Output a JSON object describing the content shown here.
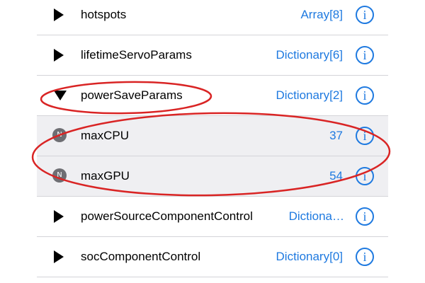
{
  "accent_color": "#1f7ae0",
  "annotation_color": "#d92424",
  "info_icon_glyph": "i",
  "rows": [
    {
      "key": "hotspots",
      "value": "Array[8]",
      "indicator": "disclosure-collapsed"
    },
    {
      "key": "lifetimeServoParams",
      "value": "Dictionary[6]",
      "indicator": "disclosure-collapsed"
    },
    {
      "key": "powerSaveParams",
      "value": "Dictionary[2]",
      "indicator": "disclosure-expanded"
    },
    {
      "key": "maxCPU",
      "value": "37",
      "indicator": "number-badge",
      "badge": "N"
    },
    {
      "key": "maxGPU",
      "value": "54",
      "indicator": "number-badge",
      "badge": "N"
    },
    {
      "key": "powerSourceComponentControl",
      "value": "Dictiona…",
      "indicator": "disclosure-collapsed"
    },
    {
      "key": "socComponentControl",
      "value": "Dictionary[0]",
      "indicator": "disclosure-collapsed"
    }
  ]
}
